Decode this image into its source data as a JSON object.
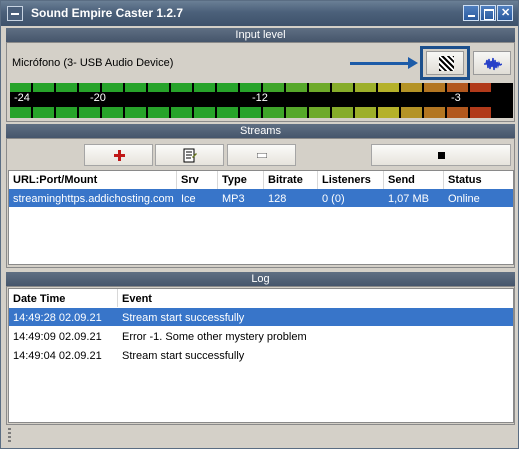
{
  "window": {
    "title": "Sound Empire Caster 1.2.7"
  },
  "input_level": {
    "header": "Input level",
    "device": "Micrófono (3- USB Audio Device)",
    "meter_ticks": [
      "-24",
      "-20",
      "-12",
      "-3"
    ],
    "level_fraction": 1.0,
    "colors": {
      "low": "#27a32a",
      "mid": "#b5b12a",
      "high": "#b13a1a"
    }
  },
  "streams": {
    "header": "Streams",
    "columns": [
      "URL:Port/Mount",
      "Srv",
      "Type",
      "Bitrate",
      "Listeners",
      "Send",
      "Status"
    ],
    "rows": [
      [
        "streaminghttps.addichosting.com",
        "Ice",
        "MP3",
        "128",
        "0 (0)",
        "1,07 MB",
        "Online"
      ]
    ],
    "selected_row": 0
  },
  "log": {
    "header": "Log",
    "columns": [
      "Date Time",
      "Event"
    ],
    "rows": [
      [
        "14:49:28 02.09.21",
        "Stream start successfully"
      ],
      [
        "14:49:09 02.09.21",
        "Error -1. Some other mystery problem"
      ],
      [
        "14:49:04 02.09.21",
        "Stream start successfully"
      ]
    ],
    "selected_row": 0
  },
  "colors": {
    "selection": "#3875c9",
    "titlebar": "#4b607a",
    "accent": "#1c5ba8"
  }
}
